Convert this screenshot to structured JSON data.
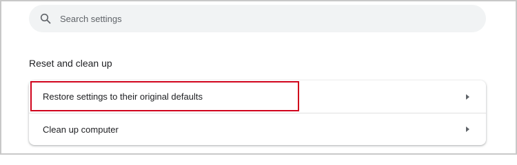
{
  "search": {
    "placeholder": "Search settings",
    "value": "",
    "icon": "search-icon"
  },
  "section": {
    "title": "Reset and clean up"
  },
  "items": [
    {
      "label": "Restore settings to their original defaults",
      "icon": "chevron-right-icon"
    },
    {
      "label": "Clean up computer",
      "icon": "chevron-right-icon"
    }
  ],
  "colors": {
    "highlight": "#d0021b",
    "search_bg": "#f1f3f4",
    "text": "#202124",
    "icon": "#5f6368"
  }
}
